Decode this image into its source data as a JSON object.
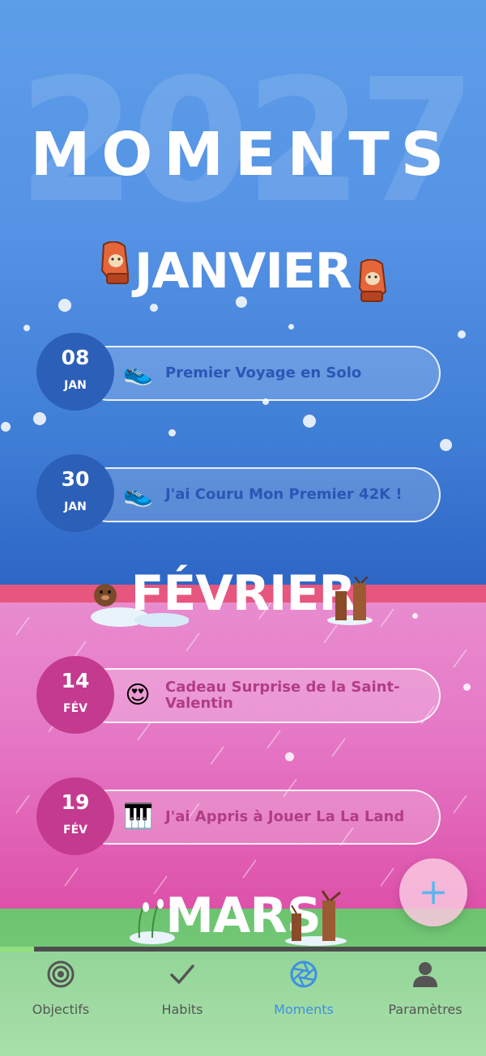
{
  "header": {
    "year_watermark": "2027",
    "title": "MOMENTS"
  },
  "months": [
    {
      "name": "JANVIER",
      "moments": [
        {
          "day": "08",
          "month": "JAN",
          "emoji": "👟",
          "label": "Premier Voyage en Solo"
        },
        {
          "day": "30",
          "month": "JAN",
          "emoji": "👟",
          "label": "J'ai Couru Mon Premier 42K !"
        }
      ]
    },
    {
      "name": "FÉVRIER",
      "moments": [
        {
          "day": "14",
          "month": "FÉV",
          "emoji": "😍",
          "label": "Cadeau Surprise de la Saint-Valentin"
        },
        {
          "day": "19",
          "month": "FÉV",
          "emoji": "🎹",
          "label": "J'ai Appris à Jouer La La Land"
        }
      ]
    },
    {
      "name": "MARS",
      "moments": []
    }
  ],
  "fab": {
    "icon": "plus-icon",
    "label": "+"
  },
  "progress": {
    "fraction": 0.07
  },
  "nav": {
    "items": [
      {
        "label": "Objectifs",
        "icon": "target-icon",
        "active": false
      },
      {
        "label": "Habits",
        "icon": "checkmark-icon",
        "active": false
      },
      {
        "label": "Moments",
        "icon": "aperture-icon",
        "active": true
      },
      {
        "label": "Paramètres",
        "icon": "user-icon",
        "active": false
      }
    ]
  },
  "colors": {
    "january": "#4f8fe3",
    "february": "#e578c6",
    "march": "#6cc46f",
    "accent": "#3f8fe4"
  }
}
